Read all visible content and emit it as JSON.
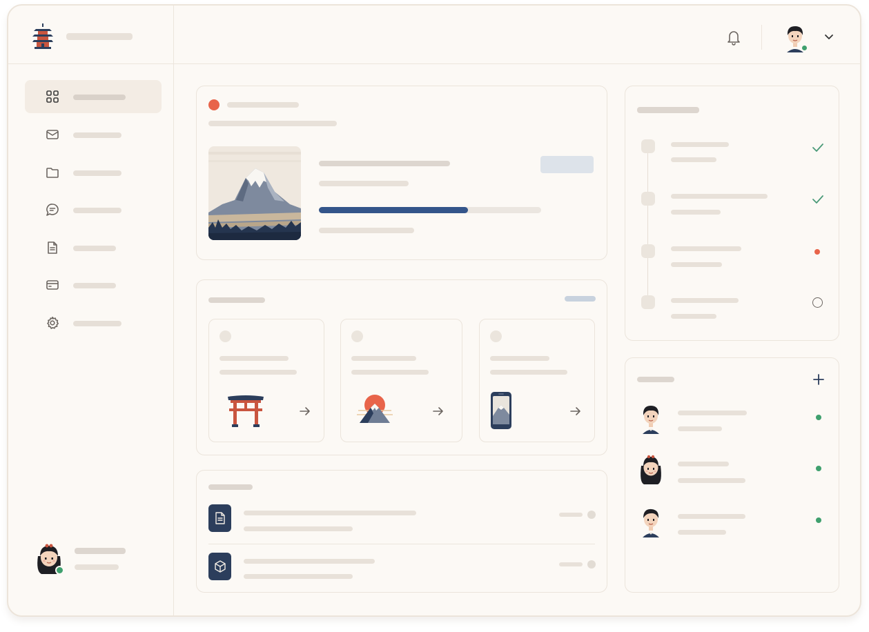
{
  "colors": {
    "accent_red": "#e8644a",
    "navy": "#2c3e5c",
    "progress_fill": "#34558a",
    "online_green": "#3fa06e",
    "check_green": "#4a9a78",
    "status_orange": "#e8644a"
  },
  "header": {
    "logo_icon": "pagoda-icon",
    "notification_icon": "bell-icon",
    "user_avatar_icon": "boy-avatar-icon",
    "menu_icon": "chevron-down-icon"
  },
  "sidebar": {
    "items": [
      {
        "icon": "grid-icon",
        "active": true
      },
      {
        "icon": "mail-icon",
        "active": false
      },
      {
        "icon": "folder-icon",
        "active": false
      },
      {
        "icon": "chat-icon",
        "active": false
      },
      {
        "icon": "document-icon",
        "active": false
      },
      {
        "icon": "card-icon",
        "active": false
      },
      {
        "icon": "gear-icon",
        "active": false
      }
    ],
    "user_avatar_icon": "girl-avatar-icon"
  },
  "featured": {
    "image_icon": "mount-fuji-illustration",
    "progress": 0.67
  },
  "shortcuts": [
    {
      "illustration": "torii-gate-icon",
      "arrow": "arrow-right-icon"
    },
    {
      "illustration": "rising-sun-icon",
      "arrow": "arrow-right-icon"
    },
    {
      "illustration": "phone-icon",
      "arrow": "arrow-right-icon"
    }
  ],
  "files": [
    {
      "icon": "file-icon"
    },
    {
      "icon": "box-icon"
    }
  ],
  "timeline": [
    {
      "status": "done",
      "status_icon": "check-icon"
    },
    {
      "status": "done",
      "status_icon": "check-icon"
    },
    {
      "status": "in-progress",
      "status_icon": "dot-icon"
    },
    {
      "status": "pending",
      "status_icon": "circle-icon"
    }
  ],
  "team": {
    "add_icon": "plus-icon",
    "members": [
      {
        "avatar": "boy-avatar-icon",
        "online": true
      },
      {
        "avatar": "girl-avatar-icon",
        "online": true
      },
      {
        "avatar": "boy-avatar-icon",
        "online": true
      }
    ]
  }
}
